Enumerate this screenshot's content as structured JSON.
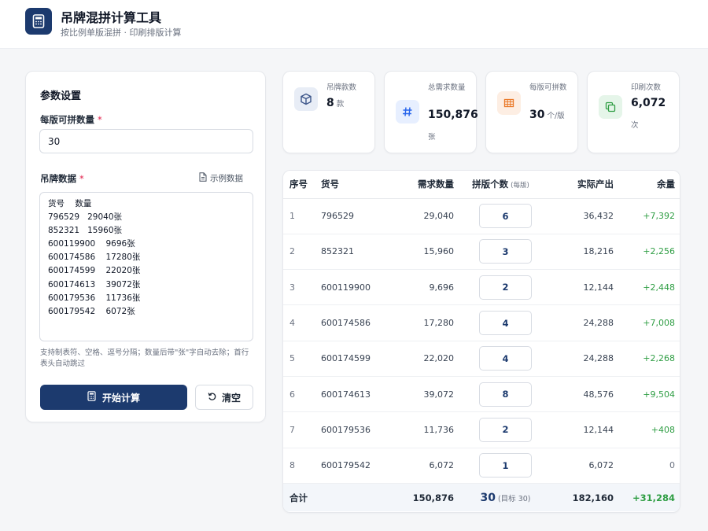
{
  "app": {
    "title": "吊牌混拼计算工具",
    "subtitle": "按比例单版混拼 · 印刷排版计算",
    "logo_icon": "calculator-icon"
  },
  "params": {
    "section_title": "参数设置",
    "per_plate_label": "每版可拼数量",
    "per_plate_value": "30",
    "data_label": "吊牌数据",
    "example_link": "示例数据",
    "data_text": "货号    数量\n796529   29040张\n852321   15960张\n600119900    9696张\n600174586    17280张\n600174599    22020张\n600174613    39072张\n600179536    11736张\n600179542    6072张",
    "hint": "支持制表符、空格、逗号分隔；数量后带\"张\"字自动去除；首行表头自动跳过",
    "start_button": "开始计算",
    "clear_button": "清空",
    "required_mark": "*"
  },
  "stats": [
    {
      "label": "吊牌款数",
      "value": "8",
      "unit": "款",
      "icon": "box-icon",
      "color": "#3b5488",
      "bg": "#e8edf6"
    },
    {
      "label": "总需求数量",
      "value": "150,876",
      "unit": "张",
      "icon": "hash-icon",
      "color": "#2563eb",
      "bg": "#e7efff"
    },
    {
      "label": "每版可拼数",
      "value": "30",
      "unit": "个/版",
      "icon": "grid-icon",
      "color": "#ea7a2a",
      "bg": "#fdeee3"
    },
    {
      "label": "印刷次数",
      "value": "6,072",
      "unit": "次",
      "icon": "copy-icon",
      "color": "#2f9e44",
      "bg": "#e5f5e9"
    }
  ],
  "table": {
    "headers": {
      "idx": "序号",
      "sku": "货号",
      "demand": "需求数量",
      "pin": "拼版个数",
      "pin_hint": "(每版)",
      "output": "实际产出",
      "remainder": "余量"
    },
    "rows": [
      {
        "idx": "1",
        "sku": "796529",
        "demand": "29,040",
        "pin": "6",
        "output": "36,432",
        "remainder": "+7,392"
      },
      {
        "idx": "2",
        "sku": "852321",
        "demand": "15,960",
        "pin": "3",
        "output": "18,216",
        "remainder": "+2,256"
      },
      {
        "idx": "3",
        "sku": "600119900",
        "demand": "9,696",
        "pin": "2",
        "output": "12,144",
        "remainder": "+2,448"
      },
      {
        "idx": "4",
        "sku": "600174586",
        "demand": "17,280",
        "pin": "4",
        "output": "24,288",
        "remainder": "+7,008"
      },
      {
        "idx": "5",
        "sku": "600174599",
        "demand": "22,020",
        "pin": "4",
        "output": "24,288",
        "remainder": "+2,268"
      },
      {
        "idx": "6",
        "sku": "600174613",
        "demand": "39,072",
        "pin": "8",
        "output": "48,576",
        "remainder": "+9,504"
      },
      {
        "idx": "7",
        "sku": "600179536",
        "demand": "11,736",
        "pin": "2",
        "output": "12,144",
        "remainder": "+408"
      },
      {
        "idx": "8",
        "sku": "600179542",
        "demand": "6,072",
        "pin": "1",
        "output": "6,072",
        "remainder": "0"
      }
    ],
    "total": {
      "label": "合计",
      "demand": "150,876",
      "pin": "30",
      "target": "(目标 30)",
      "output": "182,160",
      "remainder": "+31,284"
    }
  },
  "colors": {
    "primary": "#1c3a6e",
    "positive": "#2f9e44",
    "required": "#e11d48"
  }
}
